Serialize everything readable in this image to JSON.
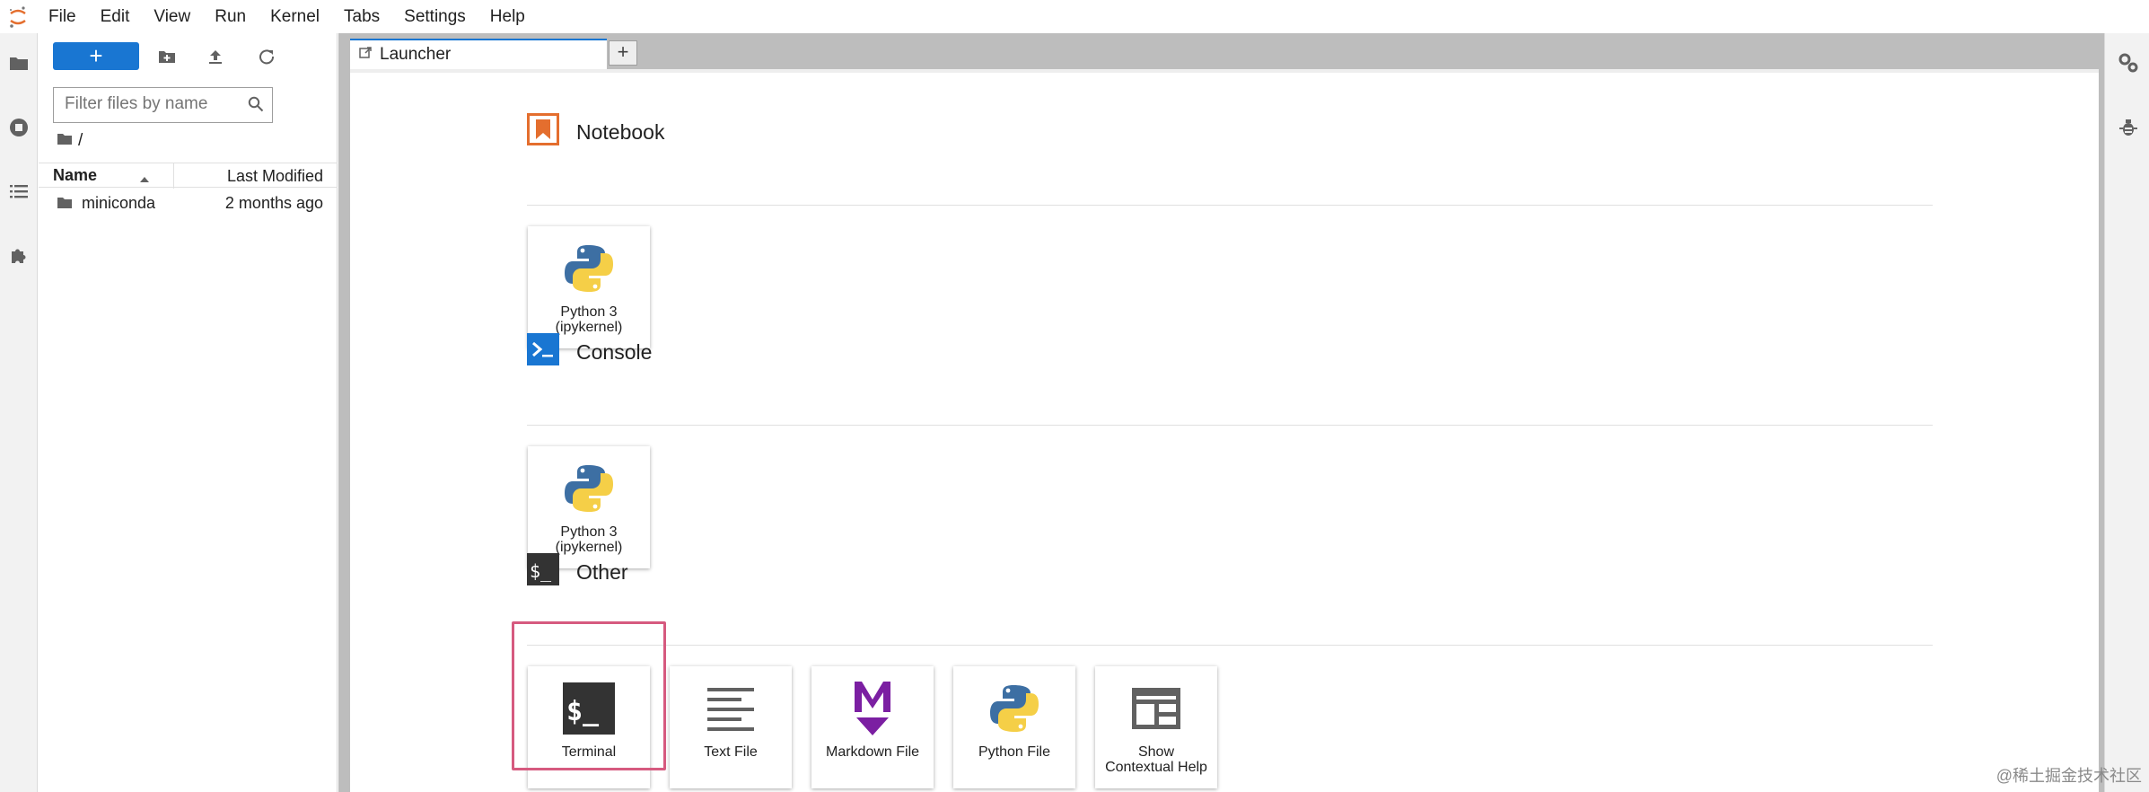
{
  "menu": [
    "File",
    "Edit",
    "View",
    "Run",
    "Kernel",
    "Tabs",
    "Settings",
    "Help"
  ],
  "file_browser": {
    "new_button_label": "+",
    "filter_placeholder": "Filter files by name",
    "breadcrumb": "/",
    "columns": {
      "name": "Name",
      "modified": "Last Modified"
    },
    "rows": [
      {
        "name": "miniconda",
        "modified": "2 months ago"
      }
    ]
  },
  "tabs": {
    "active_label": "Launcher",
    "add_label": "+"
  },
  "launcher": {
    "sections": {
      "notebook": "Notebook",
      "console": "Console",
      "other": "Other"
    },
    "notebook_card": "Python 3\n(ipykernel)",
    "console_card": "Python 3\n(ipykernel)",
    "other_cards": {
      "terminal": "Terminal",
      "text_file": "Text File",
      "markdown_file": "Markdown File",
      "python_file": "Python File",
      "contextual_help": "Show\nContextual Help"
    }
  },
  "watermark": "@稀土掘金技术社区",
  "colors": {
    "accent": "#1976d2",
    "highlight": "#d65a7f",
    "notebook_icon": "#e46e2e",
    "console_icon": "#0d47a1",
    "markdown_icon": "#7b1fa2"
  }
}
